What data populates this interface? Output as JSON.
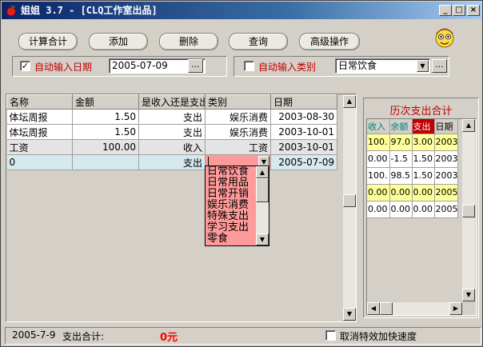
{
  "window": {
    "title": "姐姐 3.7 - [CLQ工作室出品]"
  },
  "toolbar": {
    "calc_total": "计算合计",
    "add": "添加",
    "delete": "删除",
    "query": "查询",
    "advanced": "高级操作"
  },
  "options": {
    "auto_date_checked": "✓",
    "auto_date_label": "自动输入日期",
    "date_value": "2005-07-09",
    "browse": "...",
    "auto_category_label": "自动输入类别",
    "category_value": "日常饮食",
    "browse2": "..."
  },
  "grid": {
    "headers": [
      "名称",
      "金额",
      "是收入还是支出",
      "类别",
      "日期"
    ],
    "rows": [
      {
        "name": "体坛周报",
        "amount": "1.50",
        "type": "支出",
        "category": "娱乐消费",
        "date": "2003-08-30"
      },
      {
        "name": "体坛周报",
        "amount": "1.50",
        "type": "支出",
        "category": "娱乐消费",
        "date": "2003-10-01"
      },
      {
        "name": "工资",
        "amount": "100.00",
        "type": "收入",
        "category": "工资",
        "date": "2003-10-01"
      },
      {
        "name": "0",
        "amount": "",
        "type": "支出",
        "category": "",
        "date": "2005-07-09"
      }
    ]
  },
  "dropdown": {
    "items": [
      "日常饮食",
      "日常用品",
      "日常开销",
      "娱乐消费",
      "特殊支出",
      "学习支出",
      "零食"
    ]
  },
  "side": {
    "title": "历次支出合计",
    "headers": [
      "收入",
      "余额",
      "支出",
      "日期"
    ],
    "rows": [
      [
        "100.",
        "97.0",
        "3.00",
        "2003"
      ],
      [
        "0.00",
        "-1.5",
        "1.50",
        "2003"
      ],
      [
        "100.",
        "98.5",
        "1.50",
        "2003"
      ],
      [
        "0.00",
        "0.00",
        "0.00",
        "2005"
      ],
      [
        "0.00",
        "0.00",
        "0.00",
        "2005"
      ]
    ],
    "highlight_rows": [
      0,
      3
    ]
  },
  "status": {
    "date": "2005-7-9",
    "expense_label": "支出合计:",
    "expense_value": "0元",
    "speed_label": "取消特效加快速度"
  },
  "colors": {
    "title_start": "#0a246a",
    "row_selected": "#d6e9ee",
    "dropdown": "#ff9a9a",
    "side_highlight": "#ffff99",
    "side_header": "#008080",
    "status_value": "#ff0000",
    "label_red": "#c00000"
  },
  "icons": {
    "app": "red-apple-icon",
    "mascot": "cartoon-face-icon"
  }
}
